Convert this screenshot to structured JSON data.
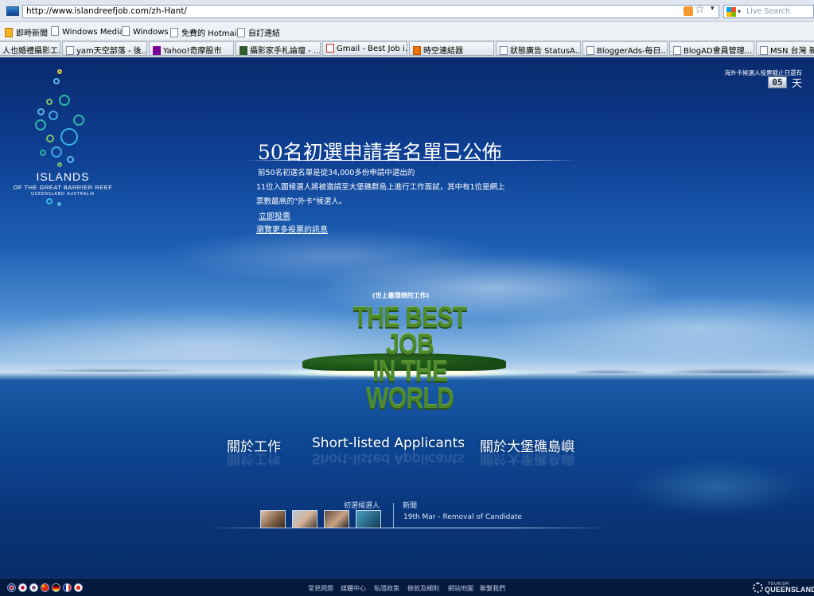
{
  "browser": {
    "url": "http://www.islandreefjob.com/zh-Hant/",
    "search_placeholder": "Live Search",
    "links": [
      "即時新聞",
      "Windows Media",
      "Windows",
      "免費的 Hotmail",
      "自訂連結"
    ],
    "tabs": [
      "人也婚禮攝影工...",
      "yam天空部落 - 後...",
      "Yahoo!奇摩股市",
      "攝影家手札論壇 - ...",
      "Gmail - Best Job i...",
      "時空連結器",
      "狀態廣告 StatusA...",
      "BloggerAds-每日...",
      "BlogAD會員管理...",
      "MSN 台灣 新"
    ]
  },
  "logo": {
    "title": "ISLANDS",
    "subtitle": "OF THE GREAT BARRIER REEF",
    "subtitle2": "QUEENSLAND AUSTRALIA"
  },
  "countdown": {
    "label": "海外卡候選人投票截止日還有",
    "value": "05",
    "unit": "天"
  },
  "headline": "50名初選申請者名單已公佈",
  "body": {
    "line1": "前50名初選名單是從34,000多份申請中選出的",
    "line2": "11位入圍候選人將被邀請至大堡礁群島上進行工作面試，其中有1位是網上",
    "line3": "票數最高的\"外卡\"候選人。",
    "link_vote": "立即投票",
    "link_more": "瀏覽更多投票的訊息"
  },
  "tagline": "(世上最理想的工作)",
  "bestjob": {
    "line1": "THE BEST JOB",
    "line2": "IN THE WORLD"
  },
  "nav": {
    "about_job": "關於工作",
    "shortlisted": "Short-listed Applicants",
    "about_islands": "關於大堡礁島嶼"
  },
  "strip": {
    "applicants_label": "初選候選人",
    "news_label": "新聞",
    "news_item": "19th Mar - Removal of Candidate"
  },
  "footer": {
    "links": [
      "常見問題",
      "媒體中心",
      "私隱政策",
      "條款及細則",
      "網站地圖",
      "聯繫我們"
    ],
    "brand_top": "TOURISM",
    "brand": "QUEENSLAND"
  },
  "colors": {
    "page_sky": "#0e3f93",
    "logo_green": "#4e8a2c",
    "footer_bg": "#06193f"
  }
}
